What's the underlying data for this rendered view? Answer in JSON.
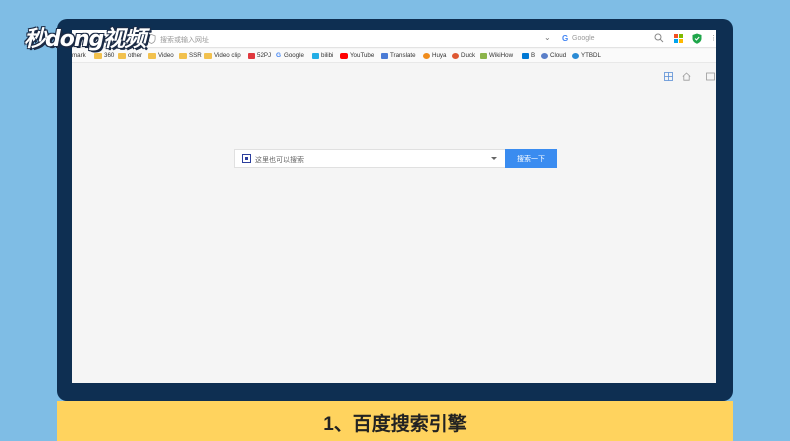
{
  "logo": {
    "text": "秒dong视频"
  },
  "browser": {
    "address_placeholder": "搜索或输入网址",
    "search_engine_label": "Google",
    "bookmarks": [
      {
        "label": "mark",
        "icon": "none"
      },
      {
        "label": "360",
        "icon": "folder-icon"
      },
      {
        "label": "other",
        "icon": "folder-icon"
      },
      {
        "label": "Video",
        "icon": "folder-icon"
      },
      {
        "label": "SSR",
        "icon": "folder-icon"
      },
      {
        "label": "Video clip",
        "icon": "folder-icon"
      },
      {
        "label": "52PJ",
        "icon": "52pj-icon"
      },
      {
        "label": "Google",
        "icon": "google-icon"
      },
      {
        "label": "bilibi",
        "icon": "bilibili-icon"
      },
      {
        "label": "YouTube",
        "icon": "youtube-icon"
      },
      {
        "label": "Translate",
        "icon": "translate-icon"
      },
      {
        "label": "Huya",
        "icon": "huya-icon"
      },
      {
        "label": "Duck",
        "icon": "duck-icon"
      },
      {
        "label": "WikiHow",
        "icon": "wikihow-icon"
      },
      {
        "label": "B",
        "icon": "bing-icon"
      },
      {
        "label": "Cloud",
        "icon": "cloud-icon"
      },
      {
        "label": "YTBDL",
        "icon": "ytbdl-icon"
      }
    ]
  },
  "search": {
    "placeholder": "这里也可以搜索",
    "button_label": "搜索一下"
  },
  "caption": {
    "text": "1、百度搜索引擎"
  },
  "colors": {
    "background": "#7fbde5",
    "bezel": "#0e2f52",
    "caption_bg": "#ffd35e",
    "search_button": "#3a8cf0",
    "screen": "#f5f5f5"
  }
}
